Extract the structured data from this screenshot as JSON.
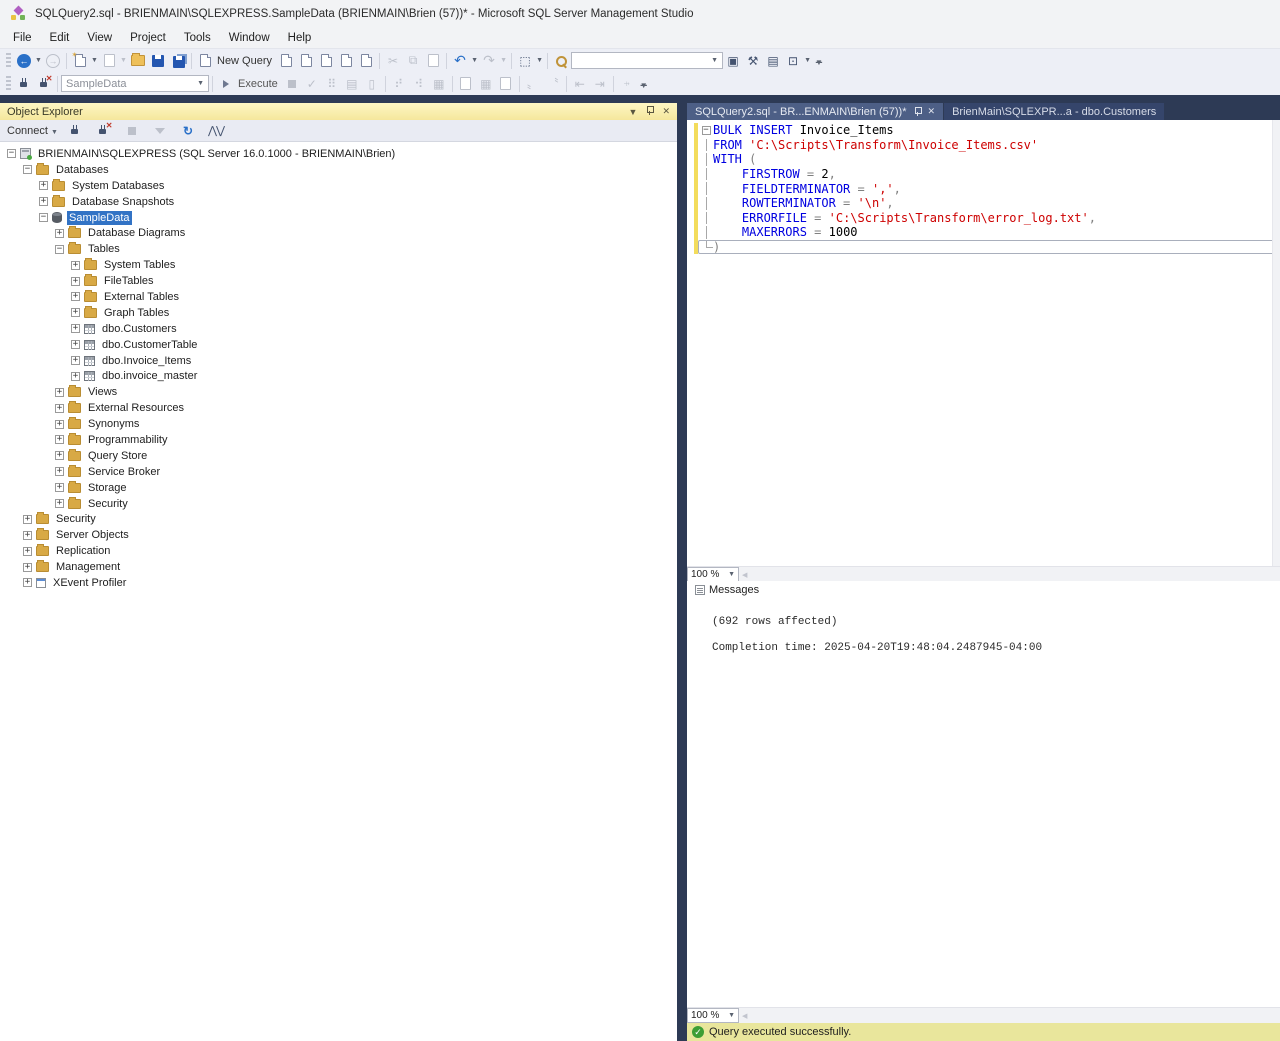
{
  "window": {
    "title": "SQLQuery2.sql - BRIENMAIN\\SQLEXPRESS.SampleData (BRIENMAIN\\Brien (57))* - Microsoft SQL Server Management Studio"
  },
  "menu": {
    "items": [
      "File",
      "Edit",
      "View",
      "Project",
      "Tools",
      "Window",
      "Help"
    ]
  },
  "toolbar": {
    "new_query_label": "New Query",
    "quick_find_value": "",
    "database_combo_value": "SampleData",
    "execute_label": "Execute"
  },
  "object_explorer": {
    "title": "Object Explorer",
    "connect_label": "Connect",
    "tree": [
      {
        "d": 0,
        "e": "minus",
        "i": "server",
        "t": "BRIENMAIN\\SQLEXPRESS (SQL Server 16.0.1000 - BRIENMAIN\\Brien)"
      },
      {
        "d": 1,
        "e": "minus",
        "i": "folder",
        "t": "Databases"
      },
      {
        "d": 2,
        "e": "plus",
        "i": "folder",
        "t": "System Databases"
      },
      {
        "d": 2,
        "e": "plus",
        "i": "folder",
        "t": "Database Snapshots"
      },
      {
        "d": 2,
        "e": "minus",
        "i": "db",
        "t": "SampleData",
        "sel": true
      },
      {
        "d": 3,
        "e": "plus",
        "i": "folder",
        "t": "Database Diagrams"
      },
      {
        "d": 3,
        "e": "minus",
        "i": "folder",
        "t": "Tables"
      },
      {
        "d": 4,
        "e": "plus",
        "i": "folder",
        "t": "System Tables"
      },
      {
        "d": 4,
        "e": "plus",
        "i": "folder",
        "t": "FileTables"
      },
      {
        "d": 4,
        "e": "plus",
        "i": "folder",
        "t": "External Tables"
      },
      {
        "d": 4,
        "e": "plus",
        "i": "folder",
        "t": "Graph Tables"
      },
      {
        "d": 4,
        "e": "plus",
        "i": "table",
        "t": "dbo.Customers"
      },
      {
        "d": 4,
        "e": "plus",
        "i": "table",
        "t": "dbo.CustomerTable"
      },
      {
        "d": 4,
        "e": "plus",
        "i": "table",
        "t": "dbo.Invoice_Items"
      },
      {
        "d": 4,
        "e": "plus",
        "i": "table",
        "t": "dbo.invoice_master"
      },
      {
        "d": 3,
        "e": "plus",
        "i": "folder",
        "t": "Views"
      },
      {
        "d": 3,
        "e": "plus",
        "i": "folder",
        "t": "External Resources"
      },
      {
        "d": 3,
        "e": "plus",
        "i": "folder",
        "t": "Synonyms"
      },
      {
        "d": 3,
        "e": "plus",
        "i": "folder",
        "t": "Programmability"
      },
      {
        "d": 3,
        "e": "plus",
        "i": "folder",
        "t": "Query Store"
      },
      {
        "d": 3,
        "e": "plus",
        "i": "folder",
        "t": "Service Broker"
      },
      {
        "d": 3,
        "e": "plus",
        "i": "folder",
        "t": "Storage"
      },
      {
        "d": 3,
        "e": "plus",
        "i": "folder",
        "t": "Security"
      },
      {
        "d": 1,
        "e": "plus",
        "i": "folder",
        "t": "Security"
      },
      {
        "d": 1,
        "e": "plus",
        "i": "folder",
        "t": "Server Objects"
      },
      {
        "d": 1,
        "e": "plus",
        "i": "folder",
        "t": "Replication"
      },
      {
        "d": 1,
        "e": "plus",
        "i": "folder",
        "t": "Management"
      },
      {
        "d": 1,
        "e": "plus",
        "i": "xevent",
        "t": "XEvent Profiler"
      }
    ]
  },
  "editor": {
    "tabs": [
      {
        "label": "SQLQuery2.sql - BR...ENMAIN\\Brien (57))*",
        "active": true
      },
      {
        "label": "BrienMain\\SQLEXPR...a - dbo.Customers",
        "active": false
      }
    ],
    "zoom_value": "100 %",
    "code_lines": [
      {
        "outline": "start",
        "tokens": [
          [
            "kw",
            "BULK INSERT"
          ],
          [
            "pl",
            " Invoice_Items"
          ]
        ]
      },
      {
        "outline": "mid",
        "tokens": [
          [
            "kw",
            "FROM"
          ],
          [
            "pl",
            " "
          ],
          [
            "str",
            "'C:\\Scripts\\Transform\\Invoice_Items.csv'"
          ]
        ]
      },
      {
        "outline": "mid",
        "tokens": [
          [
            "kw",
            "WITH"
          ],
          [
            "pl",
            " "
          ],
          [
            "op",
            "("
          ]
        ]
      },
      {
        "outline": "mid",
        "tokens": [
          [
            "pl",
            "    "
          ],
          [
            "kw",
            "FIRSTROW"
          ],
          [
            "op",
            " = "
          ],
          [
            "num",
            "2"
          ],
          [
            "op",
            ","
          ]
        ]
      },
      {
        "outline": "mid",
        "tokens": [
          [
            "pl",
            "    "
          ],
          [
            "kw",
            "FIELDTERMINATOR"
          ],
          [
            "op",
            " = "
          ],
          [
            "str",
            "','"
          ],
          [
            "op",
            ","
          ]
        ]
      },
      {
        "outline": "mid",
        "tokens": [
          [
            "pl",
            "    "
          ],
          [
            "kw",
            "ROWTERMINATOR"
          ],
          [
            "op",
            " = "
          ],
          [
            "str",
            "'\\n'"
          ],
          [
            "op",
            ","
          ]
        ]
      },
      {
        "outline": "mid",
        "tokens": [
          [
            "pl",
            "    "
          ],
          [
            "kw",
            "ERRORFILE"
          ],
          [
            "op",
            " = "
          ],
          [
            "str",
            "'C:\\Scripts\\Transform\\error_log.txt'"
          ],
          [
            "op",
            ","
          ]
        ]
      },
      {
        "outline": "mid",
        "tokens": [
          [
            "pl",
            "    "
          ],
          [
            "kw",
            "MAXERRORS"
          ],
          [
            "op",
            " = "
          ],
          [
            "num",
            "1000"
          ]
        ]
      },
      {
        "outline": "end",
        "current": true,
        "tokens": [
          [
            "op",
            ")"
          ]
        ]
      }
    ]
  },
  "messages": {
    "tab_label": "Messages",
    "zoom_value": "100 %",
    "lines": [
      "(692 rows affected)",
      "",
      "Completion time: 2025-04-20T19:48:04.2487945-04:00"
    ]
  },
  "status_bar": {
    "text": "Query executed successfully."
  }
}
